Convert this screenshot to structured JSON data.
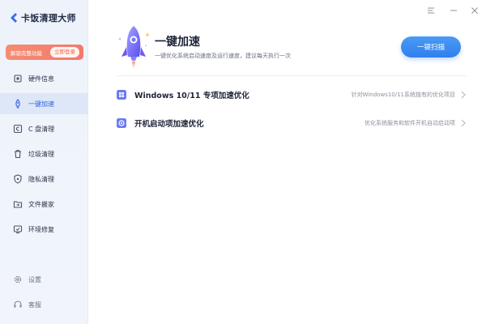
{
  "app": {
    "name": "卡饭清理大师"
  },
  "unlock": {
    "text": "解锁完整功能",
    "button": "立即登录"
  },
  "nav": {
    "items": [
      {
        "label": "硬件信息",
        "icon": "hardware-chip-icon",
        "active": false
      },
      {
        "label": "一键加速",
        "icon": "rocket-icon",
        "active": true
      },
      {
        "label": "C 盘清理",
        "icon": "disk-c-icon",
        "active": false
      },
      {
        "label": "垃圾清理",
        "icon": "trash-icon",
        "active": false
      },
      {
        "label": "隐私清理",
        "icon": "privacy-shield-icon",
        "active": false
      },
      {
        "label": "文件搬家",
        "icon": "file-move-icon",
        "active": false
      },
      {
        "label": "环境修复",
        "icon": "repair-icon",
        "active": false
      }
    ],
    "bottom": [
      {
        "label": "设置",
        "icon": "gear-icon"
      },
      {
        "label": "客服",
        "icon": "headset-icon"
      }
    ]
  },
  "header": {
    "title": "一键加速",
    "subtitle": "一键优化系统启动速度及运行速度，建议每天执行一次",
    "scan_button": "一键扫描"
  },
  "options": [
    {
      "title": "Windows 10/11 专项加速优化",
      "desc": "针对Windows10/11系统独有的优化项目",
      "icon": "windows-icon"
    },
    {
      "title": "开机启动项加速优化",
      "desc": "优化系统服务和软件开机自动启动项",
      "icon": "startup-power-icon"
    }
  ],
  "colors": {
    "accent": "#2f7ff0",
    "active_nav_bg": "#dde7f8",
    "unlock_banner": "#f27a6b"
  }
}
